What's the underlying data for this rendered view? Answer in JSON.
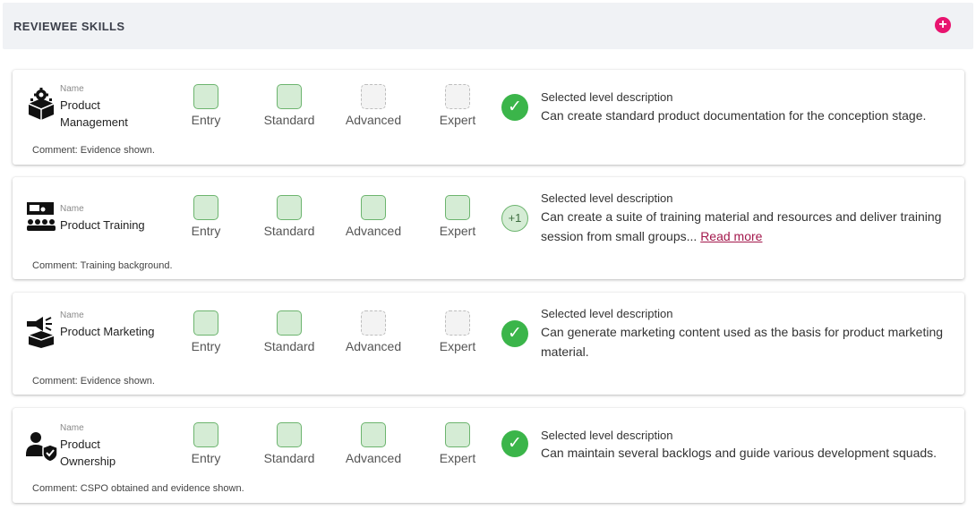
{
  "header": {
    "title": "REVIEWEE SKILLS",
    "add_icon": "plus-circle-icon",
    "accent": "#e8146f"
  },
  "name_label": "Name",
  "desc_title": "Selected level description",
  "levels": [
    "Entry",
    "Standard",
    "Advanced",
    "Expert"
  ],
  "colors": {
    "level_selected": "#d5ecd5",
    "level_empty": "#f3f3f3",
    "success": "#3bb54a"
  },
  "skills": [
    {
      "name": "Product Management",
      "icon": "box-gear-icon",
      "levels_selected": [
        true,
        true,
        false,
        false
      ],
      "status": "check",
      "status_text": "✓",
      "description": "Can create standard product documentation for the conception stage.",
      "comment": "Comment: Evidence shown."
    },
    {
      "name": "Product Training",
      "icon": "training-presenter-icon",
      "levels_selected": [
        true,
        true,
        true,
        true
      ],
      "status": "plus",
      "status_text": "+1",
      "description": "Can create a suite of training material and resources and deliver training session from small groups...",
      "read_more": "Read more",
      "comment": "Comment: Training background."
    },
    {
      "name": "Product Marketing",
      "icon": "megaphone-box-icon",
      "levels_selected": [
        true,
        true,
        false,
        false
      ],
      "status": "check",
      "status_text": "✓",
      "description": "Can generate marketing content used as the basis for product marketing material.",
      "comment": "Comment: Evidence shown."
    },
    {
      "name": "Product Ownership",
      "icon": "person-shield-icon",
      "levels_selected": [
        true,
        true,
        true,
        true
      ],
      "status": "check",
      "status_text": "✓",
      "description": "Can maintain several backlogs and guide various development squads.",
      "comment": "Comment: CSPO obtained and evidence shown."
    }
  ]
}
